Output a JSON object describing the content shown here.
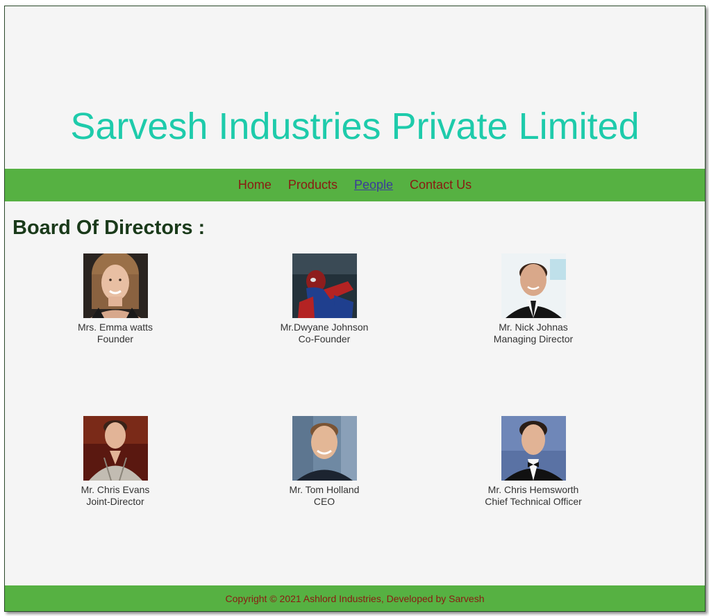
{
  "header": {
    "title": "Sarvesh Industries Private Limited"
  },
  "nav": {
    "items": [
      {
        "label": "Home"
      },
      {
        "label": "Products"
      },
      {
        "label": "People"
      },
      {
        "label": "Contact Us"
      }
    ],
    "active": "People"
  },
  "main": {
    "section_title": "Board Of Directors :",
    "people": [
      {
        "name": "Mrs. Emma watts",
        "role": "Founder",
        "photo_icon": "portrait-woman-smiling"
      },
      {
        "name": "Mr.Dwyane Johnson",
        "role": "Co-Founder",
        "photo_icon": "portrait-spiderman"
      },
      {
        "name": "Mr. Nick Johnas",
        "role": "Managing Director",
        "photo_icon": "portrait-man-suit"
      },
      {
        "name": "Mr. Chris Evans",
        "role": "Joint-Director",
        "photo_icon": "portrait-young-man"
      },
      {
        "name": "Mr. Tom Holland",
        "role": "CEO",
        "photo_icon": "portrait-man-smiling"
      },
      {
        "name": "Mr. Chris Hemsworth",
        "role": "Chief Technical Officer",
        "photo_icon": "portrait-man-tuxedo"
      }
    ]
  },
  "footer": {
    "text": "Copyright © 2021 Ashlord Industries, Developed by Sarvesh"
  },
  "colors": {
    "title": "#1ecbab",
    "nav_bar": "#56b142",
    "nav_link": "#8a1a12",
    "nav_active": "#3b3b9a",
    "page_bg": "#f5f5f5"
  }
}
